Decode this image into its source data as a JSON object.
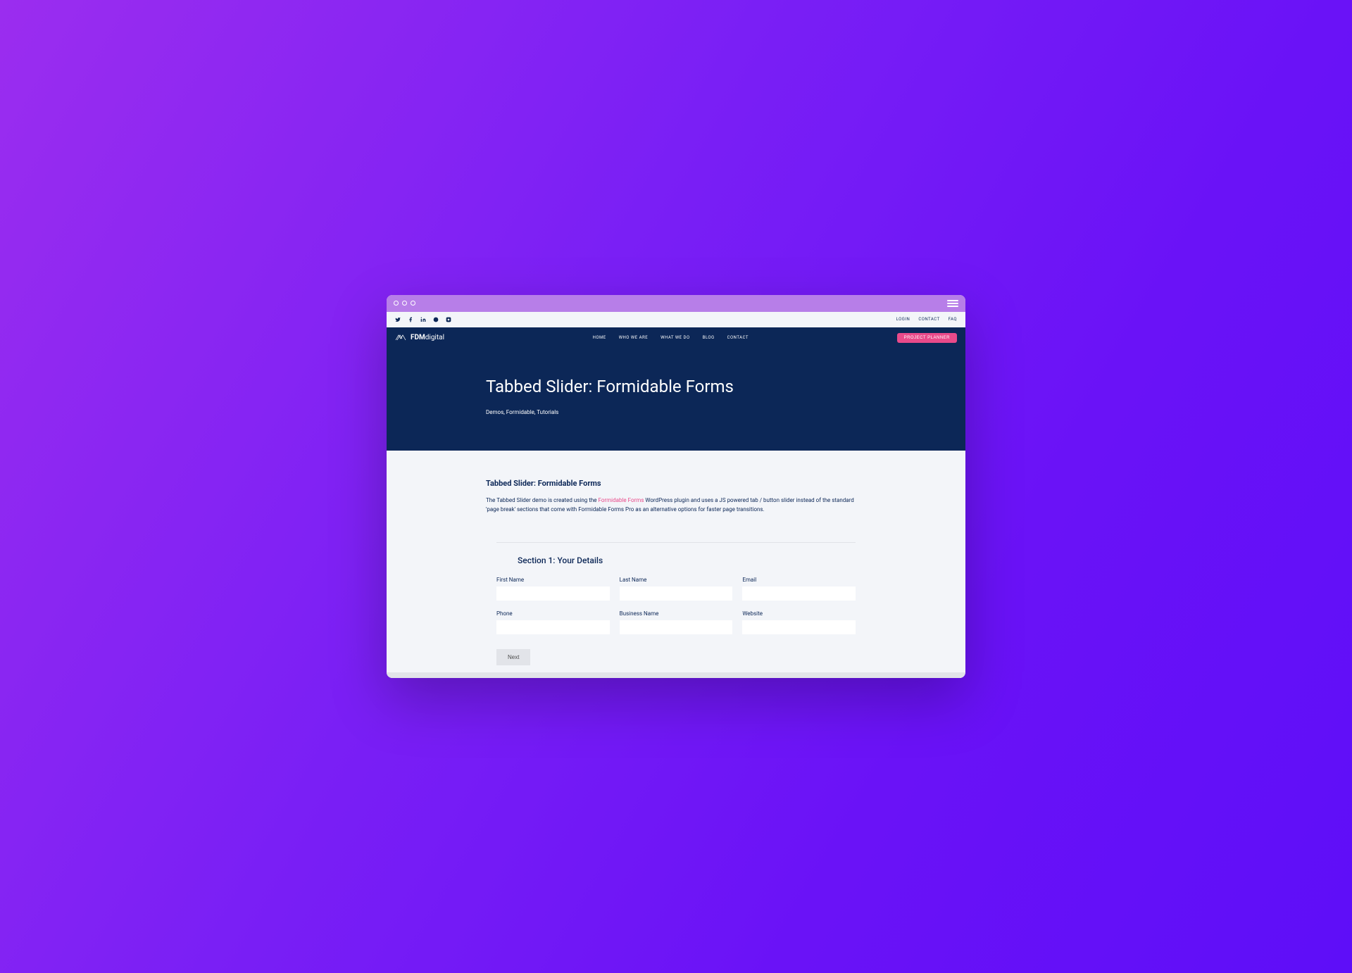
{
  "top_bar": {
    "links": {
      "login": "LOGIN",
      "contact": "CONTACT",
      "faq": "FAQ"
    }
  },
  "logo": {
    "bold": "FDM",
    "light": "digital"
  },
  "nav": {
    "home": "HOME",
    "who": "WHO WE ARE",
    "what": "WHAT WE DO",
    "blog": "BLOG",
    "contact": "CONTACT"
  },
  "project_btn": "PROJECT PLANNER",
  "hero": {
    "title": "Tabbed Slider: Formidable Forms",
    "breadcrumb": "Demos, Formidable, Tutorials"
  },
  "content": {
    "title": "Tabbed Slider: Formidable Forms",
    "desc_prefix": "The Tabbed Slider demo is created using the ",
    "desc_link": "Formidable Forms",
    "desc_suffix": " WordPress plugin and uses a JS powered tab / button slider instead of the standard 'page break' sections that come with Formidable Forms Pro as an alternative options for faster page transitions."
  },
  "form": {
    "section_title": "Section 1: Your Details",
    "labels": {
      "first_name": "First Name",
      "last_name": "Last Name",
      "email": "Email",
      "phone": "Phone",
      "business": "Business Name",
      "website": "Website"
    },
    "next": "Next"
  }
}
